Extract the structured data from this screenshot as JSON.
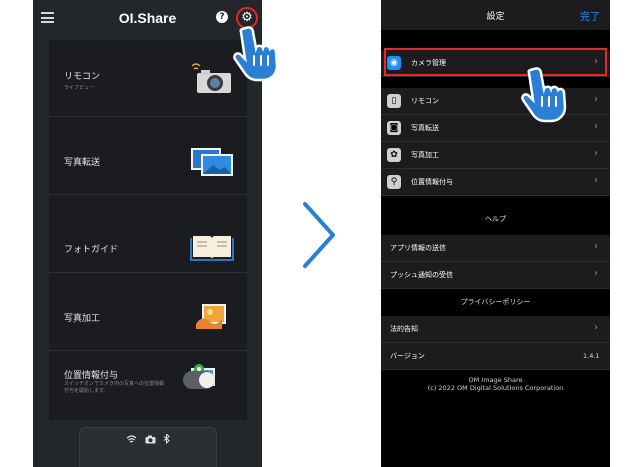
{
  "left_screen": {
    "app_title": "OI.Share",
    "help_symbol": "?",
    "menu": [
      {
        "label": "リモコン",
        "sublabel": "ライブビュー",
        "icon": "camera-remote-icon"
      },
      {
        "label": "写真転送",
        "sublabel": "",
        "icon": "photo-transfer-icon"
      },
      {
        "label": "フォトガイド",
        "sublabel": "",
        "icon": "photo-guide-book-icon"
      },
      {
        "label": "写真加工",
        "sublabel": "",
        "icon": "photo-edit-icon"
      },
      {
        "label": "位置情報付与",
        "sublabel": "スイッチオンでカメラ内の写真への位置情報付与を開始します。",
        "icon": "location-photo-icon"
      }
    ],
    "status_icons": [
      "wifi-icon",
      "camera-icon",
      "bluetooth-icon"
    ],
    "toggle_on": false
  },
  "right_screen": {
    "title": "設定",
    "done_label": "完了",
    "rows": [
      {
        "label": "カメラ管理",
        "icon": "camera-manage-icon",
        "icon_color": "#1e8fff"
      },
      {
        "label": "リモコン",
        "icon": "remote-icon",
        "icon_color": "#d0d0d0"
      },
      {
        "label": "写真転送",
        "icon": "photo-transfer-icon",
        "icon_color": "#d0d0d0"
      },
      {
        "label": "写真加工",
        "icon": "photo-edit-icon",
        "icon_color": "#d0d0d0"
      },
      {
        "label": "位置情報付与",
        "icon": "location-icon",
        "icon_color": "#d0d0d0"
      }
    ],
    "help_section": "ヘルプ",
    "help_rows": [
      "アプリ情報の送信",
      "プッシュ通知の受信"
    ],
    "privacy_section": "プライバシーポリシー",
    "legal_label": "法的告知",
    "version_label": "バージョン",
    "version_value": "1.4.1",
    "footer_line1": "OM Image Share",
    "footer_line2": "(c) 2022 OM Digital Solutions Corporation"
  },
  "colors": {
    "highlight": "#e52727",
    "accent": "#1e8fff",
    "hand": "#2a7fd4"
  }
}
